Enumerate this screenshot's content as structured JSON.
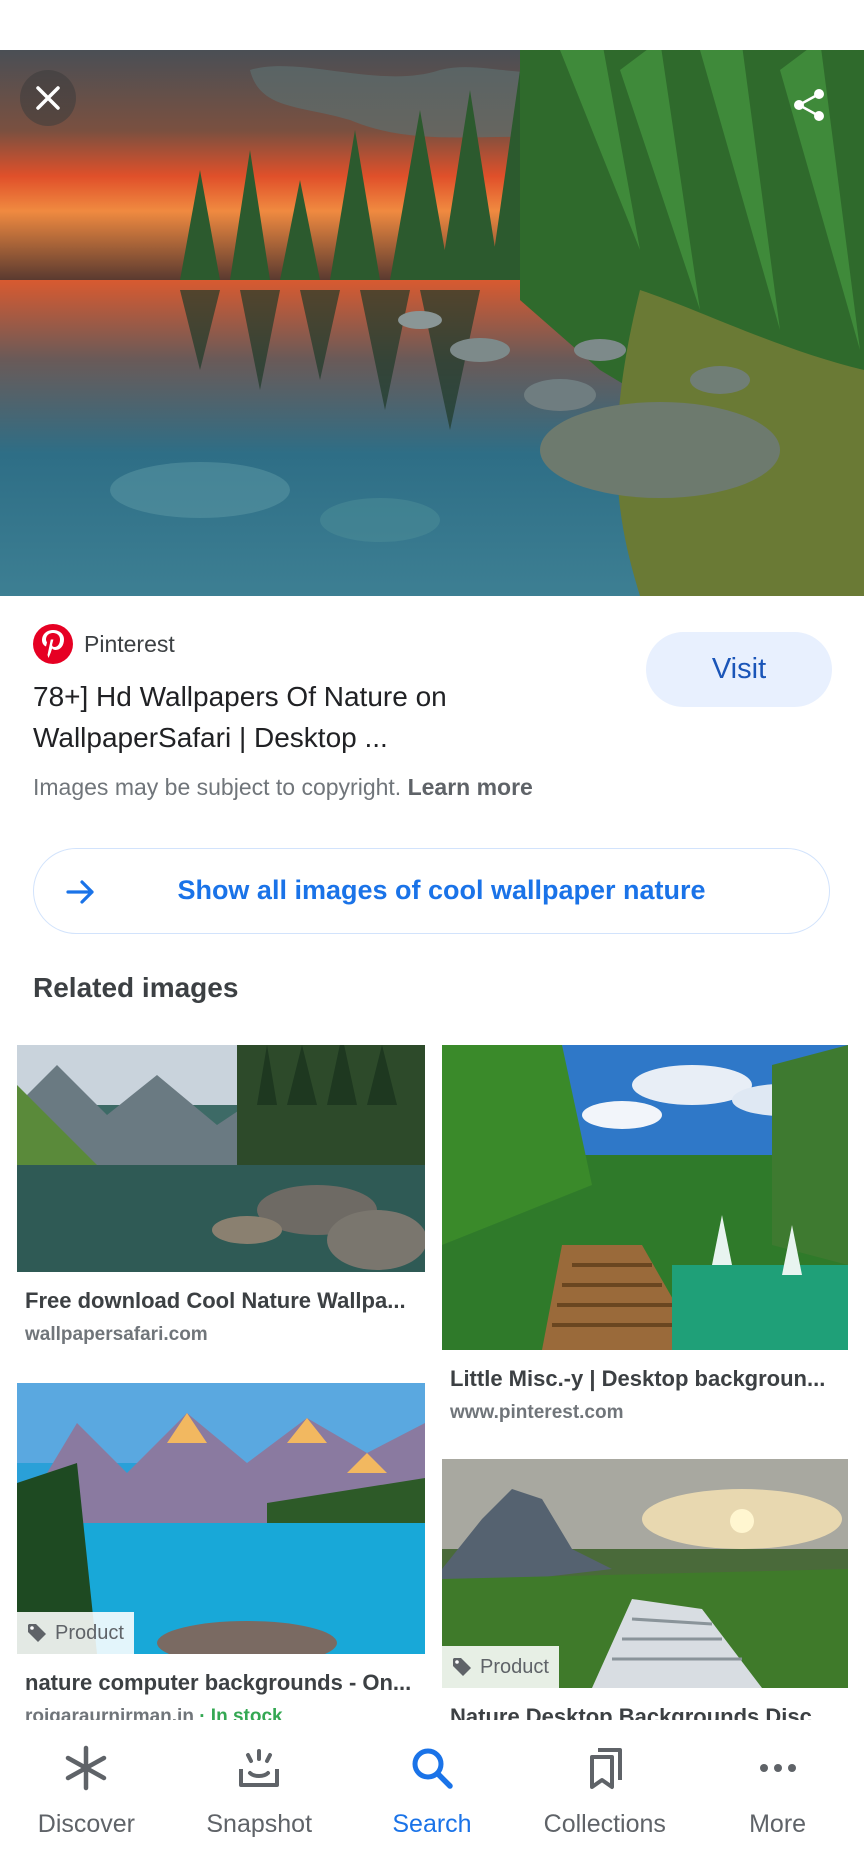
{
  "hero": {
    "close_icon": "close-icon",
    "share_icon": "share-icon"
  },
  "result": {
    "source": "Pinterest",
    "title": "78+] Hd Wallpapers Of Nature on WallpaperSafari | Desktop ...",
    "visit_label": "Visit",
    "copyright_text": "Images may be subject to copyright.",
    "learn_more": "Learn more",
    "show_all_label": "Show all images of cool wallpaper nature"
  },
  "related": {
    "heading": "Related images",
    "items": [
      {
        "title": "Free download Cool Nature Wallpa...",
        "domain": "wallpapersafari.com"
      },
      {
        "title": "Little Misc.-y | Desktop backgroun...",
        "domain": "www.pinterest.com"
      },
      {
        "title": "nature computer backgrounds - On...",
        "domain": "rojgaraurnirman.in",
        "stock": "· In stock",
        "badge": "Product"
      },
      {
        "title": "Nature Desktop Backgrounds Disc...",
        "badge": "Product"
      }
    ]
  },
  "nav": {
    "items": [
      {
        "label": "Discover",
        "icon": "asterisk-icon"
      },
      {
        "label": "Snapshot",
        "icon": "snapshot-icon"
      },
      {
        "label": "Search",
        "icon": "search-icon",
        "active": true
      },
      {
        "label": "Collections",
        "icon": "bookmarks-icon"
      },
      {
        "label": "More",
        "icon": "more-icon"
      }
    ]
  },
  "colors": {
    "accent": "#1a73e8",
    "visit_bg": "#e8f0fe",
    "pinterest_red": "#e60023",
    "in_stock": "#34a853"
  }
}
